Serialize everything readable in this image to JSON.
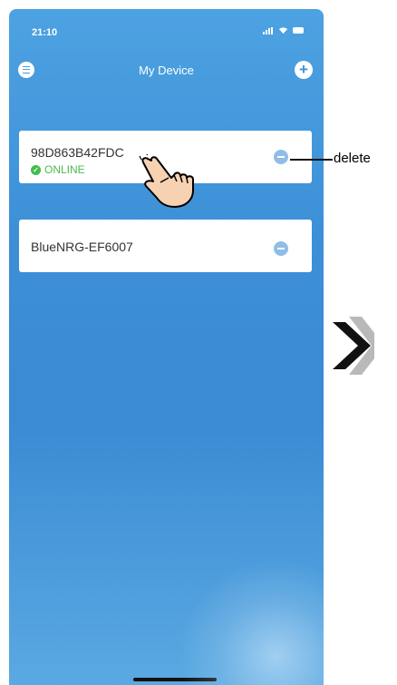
{
  "status_bar": {
    "time": "21:10"
  },
  "header": {
    "title": "My Device"
  },
  "devices": [
    {
      "name": "98D863B42FDC",
      "status": "ONLINE"
    },
    {
      "name": "BlueNRG-EF6007"
    }
  ],
  "annotation": {
    "delete_label": "delete"
  },
  "colors": {
    "accent": "#3c8fd6",
    "online": "#4cbb4e",
    "delete": "#8fbde6"
  }
}
